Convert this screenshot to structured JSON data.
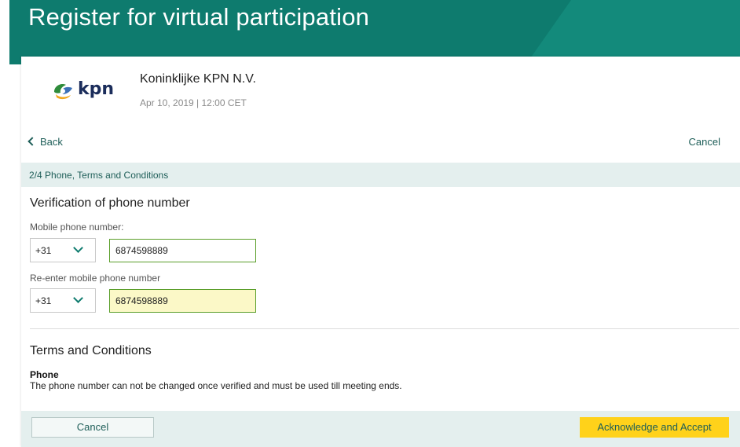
{
  "header": {
    "title": "Register for virtual participation"
  },
  "meeting": {
    "logo_text": "kpn",
    "company": "Koninklijke KPN N.V.",
    "date": "Apr 10, 2019 | 12:00 CET"
  },
  "nav": {
    "back_label": "Back",
    "cancel_label": "Cancel"
  },
  "step": {
    "label": "2/4 Phone, Terms and Conditions"
  },
  "verification": {
    "title": "Verification of phone number",
    "mobile_label": "Mobile phone number:",
    "reenter_label": "Re-enter mobile phone number",
    "country_code_1": "+31",
    "country_code_2": "+31",
    "phone_value_1": "6874598889",
    "phone_value_2": "6874598889"
  },
  "terms": {
    "title": "Terms and Conditions",
    "subtitle": "Phone",
    "text": "The phone number can not be changed once verified and must be used till meeting ends."
  },
  "footer": {
    "cancel_label": "Cancel",
    "accept_label": "Acknowledge and Accept"
  },
  "colors": {
    "brand": "#0e7b6e",
    "accent": "#ffd21a",
    "active_field": "#fbf8c7",
    "valid_border": "#5a9e2a"
  },
  "icons": {
    "back": "chevron-left-icon",
    "dropdown": "chevron-down-icon",
    "logo": "kpn-logo-icon"
  }
}
